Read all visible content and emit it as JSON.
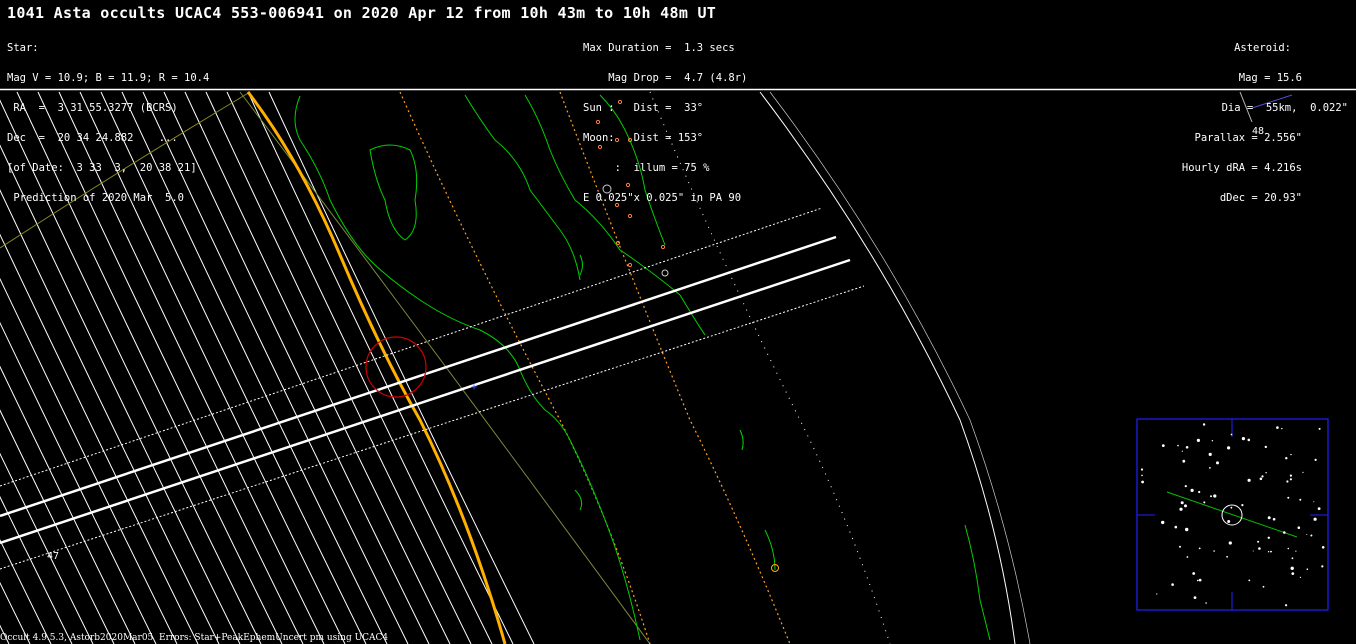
{
  "title": "1041 Asta occults UCAC4 553-006941 on 2020 Apr 12 from 10h 43m to 10h 48m UT",
  "star": {
    "heading": "Star:",
    "mag": "Mag V = 10.9; B = 11.9; R = 10.4",
    "ra": " RA  =  3 31 55.3277 (BCRS)",
    "dec": "Dec  =  20 34 24.882    ...",
    "of_date": "[of Date:  3 33  3,  20 38 21]",
    "prediction": " Prediction of 2020 Mar  5.0"
  },
  "event": {
    "max_duration": "Max Duration =  1.3 secs",
    "mag_drop": "    Mag Drop =  4.7 (4.8r)",
    "sun": "Sun :   Dist =  33°",
    "moon": "Moon:   Dist = 153°",
    "illum": "     :  illum = 75 %",
    "ellipse": "E 0.025\"x 0.025\" in PA 90"
  },
  "asteroid": {
    "heading": "Asteroid:",
    "mag": "Mag = 15.6",
    "dia": "Dia =  55km,  0.022\"",
    "parallax": "Parallax = 2.556\"",
    "hourly_dra": "Hourly dRA = 4.216s",
    "ddec": "dDec = 20.93\""
  },
  "map_labels": {
    "lat_48": "48",
    "lat_47": "47"
  },
  "footer": "Occult 4.9.5.3, Astorb2020Mar05  Errors: Star+PeakEphemUncert pm using UCAC4",
  "colors": {
    "background": "#000000",
    "coast": "#00d000",
    "path": "#ffffff",
    "terminator": "#ffb000",
    "ellipse": "#d00000",
    "finder_frame": "#2020ff"
  }
}
